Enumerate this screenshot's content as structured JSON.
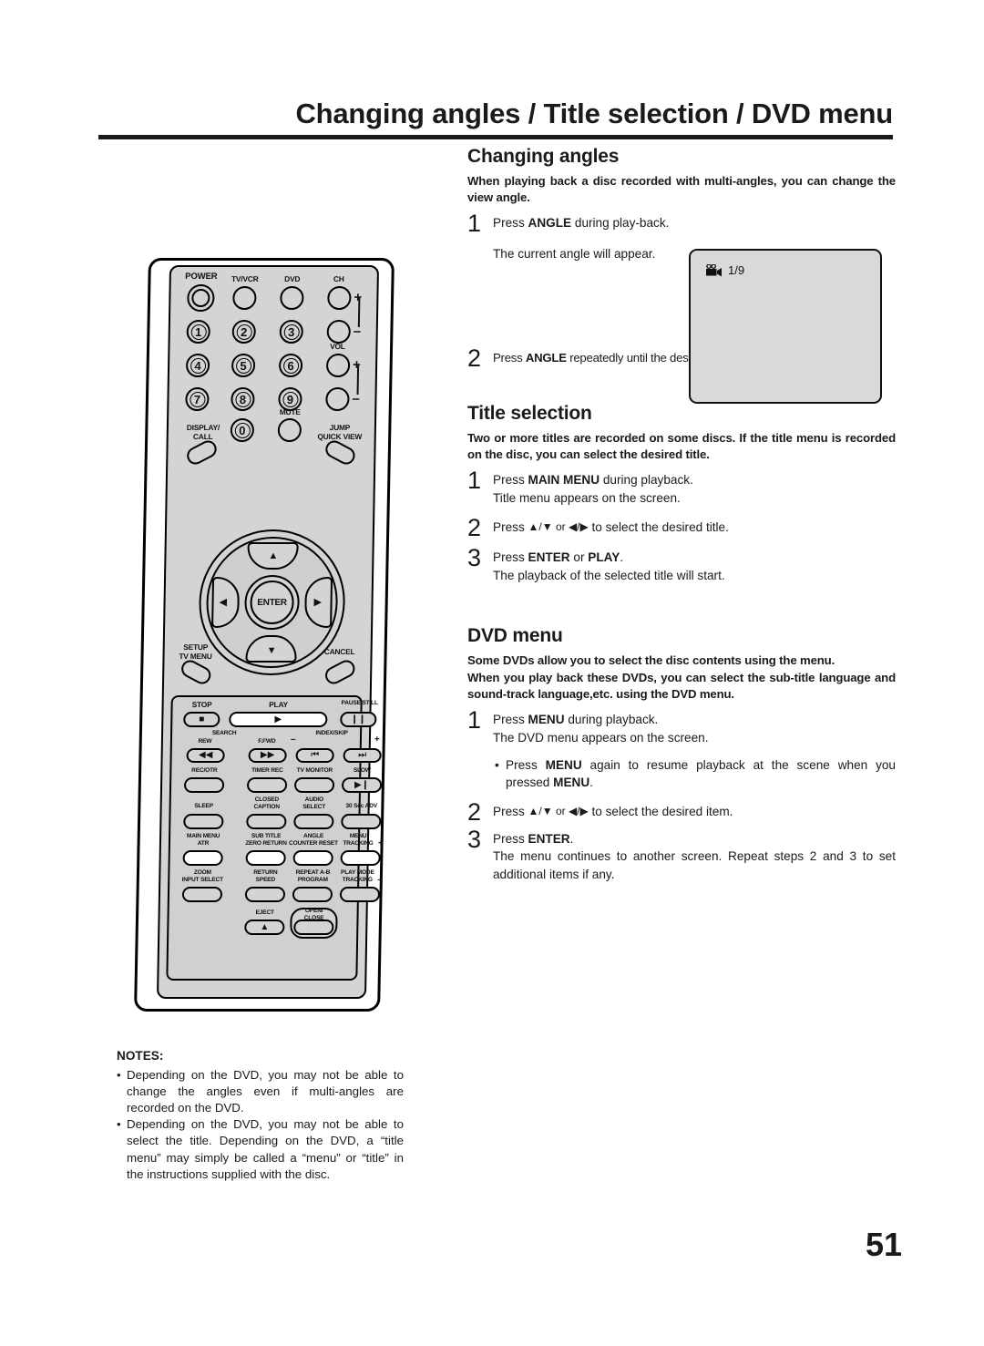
{
  "header": {
    "title": "Changing angles / Title selection / DVD menu"
  },
  "page_number": "51",
  "sections": [
    {
      "heading": "Changing angles",
      "intro": "When playing back a disc recorded with multi-angles, you can change the view angle.",
      "steps": [
        {
          "num": "1",
          "line1_pre": "Press ",
          "line1_bold": "ANGLE",
          "line1_post": " during play-back.",
          "line2": "The current angle will appear."
        },
        {
          "num": "2",
          "line1_pre": "Press ",
          "line1_bold": "ANGLE",
          "line1_post": " repeatedly until the desired angle is selected.",
          "line2": ""
        }
      ]
    },
    {
      "heading": "Title selection",
      "intro": "Two or more titles are recorded on some discs. If the title menu is recorded on the disc, you can select the desired title.",
      "steps": [
        {
          "num": "1",
          "line1_pre": "Press ",
          "line1_bold": "MAIN MENU",
          "line1_post": " during playback.",
          "line2": "Title menu appears on the screen."
        },
        {
          "num": "2",
          "line1_pre": "Press ",
          "line1_bold": "",
          "line1_post": " to select the desired title.",
          "line2": "",
          "arrows": "▲/▼ or ◀/▶"
        },
        {
          "num": "3",
          "line1_pre": "Press ",
          "line1_bold": "ENTER",
          "line1_mid": " or ",
          "line1_bold2": "PLAY",
          "line1_post": ".",
          "line2": "The playback of the selected title will start."
        }
      ]
    },
    {
      "heading": "DVD menu",
      "intro": "Some DVDs allow you to select the disc contents using the menu.\nWhen you play back these DVDs, you can select the sub-title language and sound-track language,etc. using the DVD menu.",
      "intro_line1": "Some DVDs allow you to select the disc contents using the menu.",
      "intro_line2": "When you play back these DVDs, you can select the sub-title language and sound-track language,etc. using the DVD menu.",
      "steps": [
        {
          "num": "1",
          "line1_pre": "Press ",
          "line1_bold": "MENU",
          "line1_post": " during playback.",
          "line2": "The DVD menu appears on the screen."
        },
        {
          "num": "2",
          "line1_pre": "Press ",
          "line1_post": " to select the desired item.",
          "arrows": "▲/▼ or ◀/▶"
        },
        {
          "num": "3",
          "line1_pre": "Press ",
          "line1_bold": "ENTER",
          "line1_post": ".",
          "line2": "The menu continues to another screen. Repeat steps 2 and 3 to set additional items if any."
        }
      ],
      "bullet": {
        "pre": "Press ",
        "bold1": "MENU",
        "mid": " again to resume playback at the scene when you pressed ",
        "bold2": "MENU",
        "post": "."
      }
    }
  ],
  "screen_figure": {
    "icon": "angle-camera-icon",
    "angle_indicator": "1/9"
  },
  "notes": {
    "title": "NOTES:",
    "items": [
      "Depending on the DVD, you may not be able to change the angles even if multi-angles are recorded on the DVD.",
      "Depending on the DVD, you may not be able to select the title. Depending on the DVD, a “title menu” may simply be called a “menu” or “title” in the instructions supplied with the disc."
    ]
  },
  "remote": {
    "power": "POWER",
    "tv_vcr": "TV/VCR",
    "dvd": "DVD",
    "ch": "CH",
    "vol": "VOL",
    "plus": "+",
    "minus": "–",
    "numbers": [
      "1",
      "2",
      "3",
      "4",
      "5",
      "6",
      "7",
      "8",
      "9",
      "0"
    ],
    "mute": "MUTE",
    "display_call_1": "DISPLAY/",
    "display_call_2": "CALL",
    "jump_1": "JUMP",
    "jump_2": "QUICK VIEW",
    "setup_1": "SETUP",
    "setup_2": "TV MENU",
    "cancel": "CANCEL",
    "enter": "ENTER",
    "stop": "STOP",
    "play": "PLAY",
    "pause_still": "PAUSE/STILL",
    "search": "SEARCH",
    "rew": "REW",
    "ffwd": "F.FWD",
    "index_skip": "INDEX/SKIP",
    "rec_otr": "REC/OTR",
    "timer_rec": "TIMER REC",
    "tv_monitor": "TV MONITOR",
    "slow": "SLOW",
    "sleep": "SLEEP",
    "closed_1": "CLOSED",
    "closed_2": "CAPTION",
    "audio_1": "AUDIO",
    "audio_2": "SELECT",
    "adv30": "30 Sec ADV",
    "main_menu_1": "MAIN MENU",
    "main_menu_2": "ATR",
    "subtitle_1": "SUB TITLE",
    "subtitle_2": "ZERO RETURN",
    "angle_1": "ANGLE",
    "angle_2": "COUNTER RESET",
    "menu_1": "MENU",
    "menu_2": "TRACKING",
    "zoom_1": "ZOOM",
    "zoom_2": "INPUT SELECT",
    "return_1": "RETURN",
    "return_2": "SPEED",
    "repeat_1": "REPEAT A-B",
    "repeat_2": "PROGRAM",
    "playmode_1": "PLAY MODE",
    "playmode_2": "TRACKING",
    "eject": "EJECT",
    "open_1": "OPEN/",
    "open_2": "CLOSE"
  }
}
